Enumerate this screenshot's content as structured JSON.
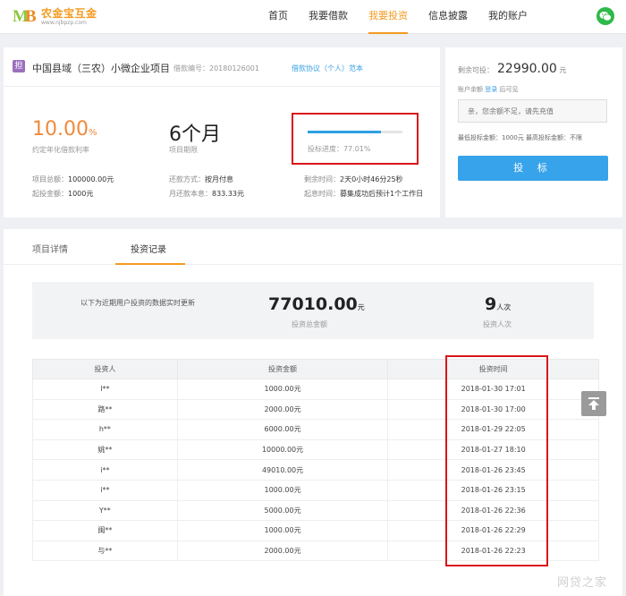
{
  "header": {
    "logo_text": "农金宝互金",
    "logo_url": "www.njbpzp.com",
    "nav": [
      {
        "label": "首页"
      },
      {
        "label": "我要借款"
      },
      {
        "label": "我要投资"
      },
      {
        "label": "信息披露"
      },
      {
        "label": "我的账户"
      }
    ],
    "active_nav": "我要投资"
  },
  "project": {
    "tag": "担",
    "title": "中国县域（三农）小微企业项目",
    "code": "借款编号：20180126001",
    "agreement": "借款协议（个人）范本",
    "rate_value": "10.00",
    "rate_unit": "%",
    "rate_label": "约定年化借款利率",
    "term_value": "6个月",
    "term_label": "项目期限",
    "progress_value": 77.01,
    "progress_label": "投标进度：77.01%",
    "total_label": "项目总额：",
    "total_value": "100000.00元",
    "min_label": "起投金额：",
    "min_value": "1000元",
    "repay_label": "还款方式：",
    "repay_value": "按月付息",
    "monthly_label": "月还款本息：",
    "monthly_value": "833.33元",
    "remain_label": "剩余时间：",
    "remain_value": "2天0小时46分25秒",
    "start_label": "起息时间：",
    "start_value": "募集成功后预计1个工作日"
  },
  "side": {
    "avail_label": "剩余可投：",
    "avail_amount": "22990.00",
    "avail_unit": "元",
    "balance_label": "账户余额",
    "balance_login": "登录",
    "balance_suffix": "后可见",
    "input_placeholder": "亲，您余额不足，请先充值",
    "limit_text": "最低投标金额：1000元 最高投标金额：不限",
    "invest_button": "投 标"
  },
  "detail": {
    "tabs": [
      {
        "label": "项目详情"
      },
      {
        "label": "投资记录"
      }
    ],
    "summary_note": "以下为近期用户投资的数据实时更新",
    "summary_amount": "77010.00",
    "summary_amount_unit": "元",
    "summary_amount_label": "投资总金额",
    "summary_count": "9",
    "summary_count_unit": "人次",
    "summary_count_label": "投资人次"
  },
  "records": {
    "columns": [
      "投资人",
      "投资金额",
      "投资时间"
    ],
    "rows": [
      [
        "l**",
        "1000.00元",
        "2018-01-30 17:01"
      ],
      [
        "路**",
        "2000.00元",
        "2018-01-30 17:00"
      ],
      [
        "h**",
        "6000.00元",
        "2018-01-29 22:05"
      ],
      [
        "姚**",
        "10000.00元",
        "2018-01-27 18:10"
      ],
      [
        "i**",
        "49010.00元",
        "2018-01-26 23:45"
      ],
      [
        "i**",
        "1000.00元",
        "2018-01-26 23:15"
      ],
      [
        "Y**",
        "5000.00元",
        "2018-01-26 22:36"
      ],
      [
        "闽**",
        "1000.00元",
        "2018-01-26 22:29"
      ],
      [
        "与**",
        "2000.00元",
        "2018-01-26 22:23"
      ]
    ]
  },
  "watermark": "网贷之家",
  "colors": {
    "accent": "#f39b20",
    "primary_blue": "#37a3ea",
    "highlight_red": "#d9151b",
    "rate_orange": "#f08a3c"
  }
}
